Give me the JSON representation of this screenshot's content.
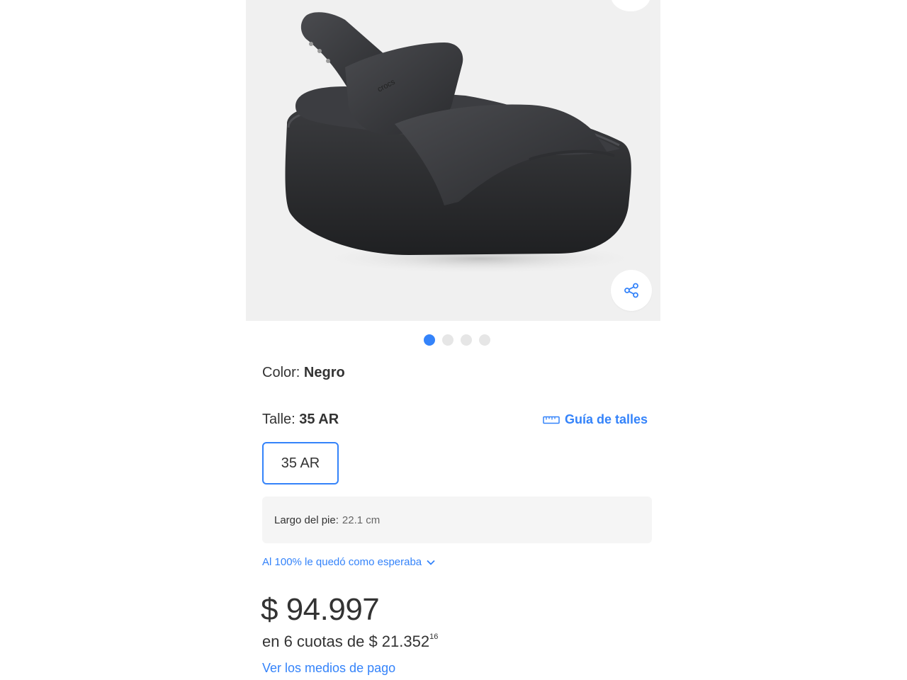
{
  "product": {
    "image_alt": "Black platform sandal",
    "brand_mark": "crocs"
  },
  "carousel": {
    "count": 4,
    "active_index": 0
  },
  "color": {
    "label": "Color: ",
    "value": "Negro"
  },
  "size": {
    "label": "Talle: ",
    "value": "35 AR",
    "options": [
      "35 AR"
    ],
    "guide_label": "Guía de talles"
  },
  "foot_length": {
    "label": "Largo del pie:",
    "value": "22.1 cm"
  },
  "fit": {
    "text": "Al 100% le quedó como esperaba"
  },
  "price": {
    "amount": "$ 94.997",
    "installments_prefix": "en 6 cuotas de $ 21.352",
    "installments_cents": "16",
    "payment_link": "Ver los medios de pago"
  },
  "icons": {
    "share": "share-icon",
    "ruler": "ruler-icon",
    "chevron": "chevron-down-icon"
  },
  "colors": {
    "accent": "#3483fa",
    "image_bg": "#f0f0f0",
    "box_bg": "#f5f5f5",
    "dot_inactive": "#e6e6e6"
  }
}
